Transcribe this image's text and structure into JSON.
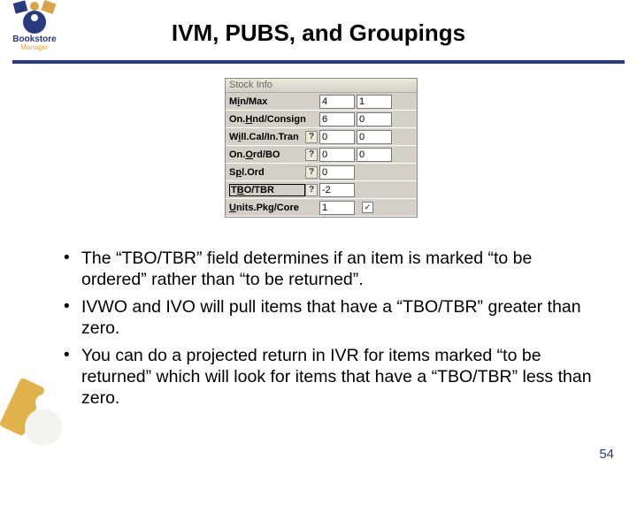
{
  "logo": {
    "line1": "Bookstore",
    "line2": "Manager"
  },
  "title": "IVM, PUBS, and Groupings",
  "stock_panel": {
    "header": "Stock Info",
    "qmark": "?",
    "check_glyph": "✓",
    "rows": [
      {
        "label_pre": "M",
        "label_ul": "i",
        "label_post": "n/Max",
        "q": false,
        "v1": "4",
        "v2": "1",
        "checkbox": false,
        "highlight": false
      },
      {
        "label_pre": "On.",
        "label_ul": "H",
        "label_post": "nd/Consign",
        "q": false,
        "v1": "6",
        "v2": "0",
        "checkbox": false,
        "highlight": false
      },
      {
        "label_pre": "W",
        "label_ul": "i",
        "label_post": "ll.Cal/In.Tran",
        "q": true,
        "v1": "0",
        "v2": "0",
        "checkbox": false,
        "highlight": false
      },
      {
        "label_pre": "On.",
        "label_ul": "O",
        "label_post": "rd/BO",
        "q": true,
        "v1": "0",
        "v2": "0",
        "checkbox": false,
        "highlight": false
      },
      {
        "label_pre": "S",
        "label_ul": "p",
        "label_post": "l.Ord",
        "q": true,
        "v1": "0",
        "v2": "",
        "checkbox": false,
        "highlight": false
      },
      {
        "label_pre": "T",
        "label_ul": "B",
        "label_post": "O/TBR",
        "q": true,
        "v1": "-2",
        "v2": "",
        "checkbox": false,
        "highlight": true
      },
      {
        "label_pre": "",
        "label_ul": "U",
        "label_post": "nits.Pkg/Core",
        "q": false,
        "v1": "1",
        "v2": "",
        "checkbox": true,
        "highlight": false
      }
    ]
  },
  "bullets": [
    "The “TBO/TBR” field determines if an item is marked “to be ordered” rather than “to be returned”.",
    "IVWO and IVO will pull items that have a “TBO/TBR” greater than zero.",
    "You can do a projected return in IVR for items marked “to be returned” which will look for items that have a “TBO/TBR” less than zero."
  ],
  "page_number": "54"
}
